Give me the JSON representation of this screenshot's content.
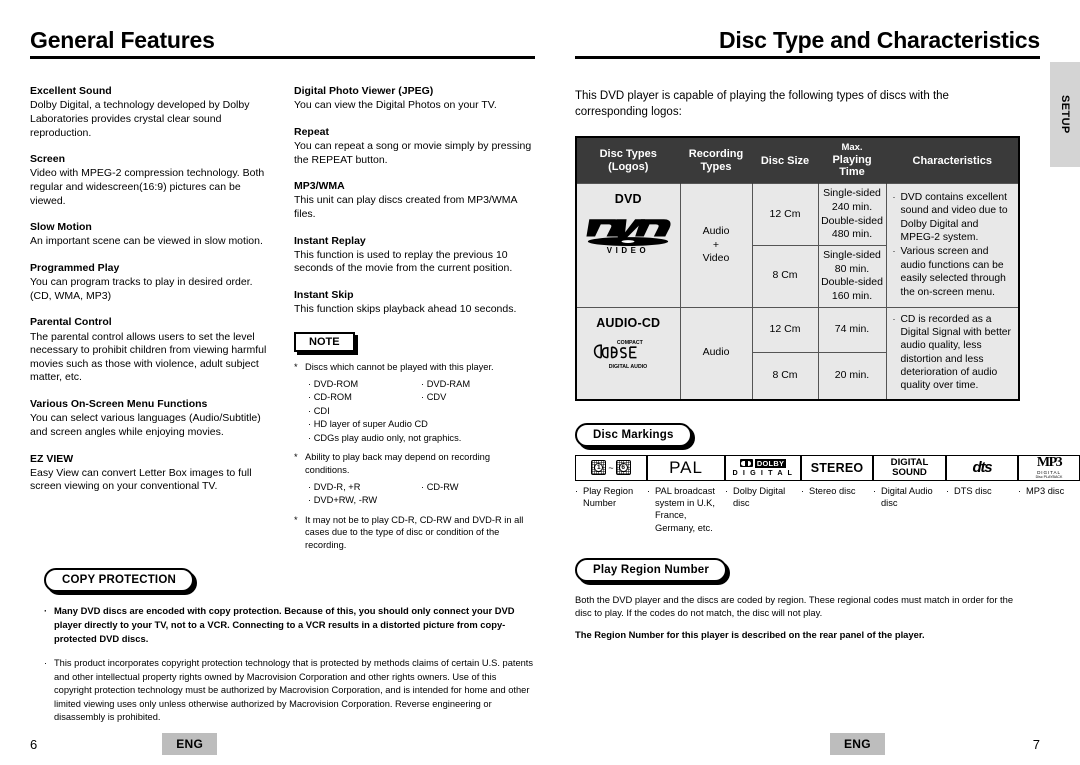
{
  "left_page": {
    "title": "General Features",
    "page_number": "6",
    "language_badge": "ENG",
    "column1": [
      {
        "heading": "Excellent Sound",
        "body": "Dolby Digital, a technology developed by Dolby Laboratories provides crystal clear sound reproduction."
      },
      {
        "heading": "Screen",
        "body": "Video with MPEG-2 compression technology. Both regular and widescreen(16:9) pictures can be viewed."
      },
      {
        "heading": "Slow Motion",
        "body": "An important scene can be viewed in slow motion."
      },
      {
        "heading": "Programmed Play",
        "body": "You can program tracks to play in desired order. (CD, WMA, MP3)"
      },
      {
        "heading": "Parental Control",
        "body": "The parental control allows users to set the level necessary to prohibit children from viewing harmful movies such as those with violence, adult subject matter, etc."
      },
      {
        "heading": "Various On-Screen Menu Functions",
        "body": "You can select various languages (Audio/Subtitle) and screen angles while enjoying movies."
      },
      {
        "heading": "EZ VIEW",
        "body": "Easy View can convert Letter Box images to full screen viewing on your conventional TV."
      }
    ],
    "column2": [
      {
        "heading": "Digital Photo Viewer (JPEG)",
        "body": "You can view the Digital Photos on your TV."
      },
      {
        "heading": "Repeat",
        "body": "You can repeat a song or movie simply by pressing the REPEAT button."
      },
      {
        "heading": "MP3/WMA",
        "body": "This unit can play discs created from MP3/WMA files."
      },
      {
        "heading": "Instant Replay",
        "body": "This function is used to replay the previous 10 seconds of the movie from the current position."
      },
      {
        "heading": "Instant Skip",
        "body": "This function skips playback ahead 10 seconds."
      }
    ],
    "note": {
      "label": "NOTE",
      "star1": "Discs which cannot be played with this player.",
      "list1": [
        "DVD-ROM",
        "DVD-RAM",
        "CD-ROM",
        "CDV"
      ],
      "list1_full": [
        "CDI",
        "HD layer of super Audio CD",
        "CDGs play audio only, not graphics."
      ],
      "star2": "Ability to play back may depend on recording conditions.",
      "list2": [
        "DVD-R, +R",
        "CD-RW"
      ],
      "list2_full": [
        "DVD+RW, -RW"
      ],
      "star3": "It may not be to play CD-R, CD-RW and DVD-R in all cases due to the type of disc or condition of the recording."
    },
    "copy_protection": {
      "label": "COPY PROTECTION",
      "items": [
        "Many DVD discs are encoded with copy protection. Because of this, you should only connect your DVD player directly to your TV, not to a VCR. Connecting to a VCR results in a distorted picture from copy-protected DVD discs.",
        "This product incorporates copyright protection technology that is protected by methods claims of certain U.S. patents and other intellectual property rights owned by Macrovision Corporation and other rights owners. Use of this copyright protection technology must be authorized by Macrovision Corporation, and is intended for home and other limited viewing uses only unless otherwise authorized by Macrovision Corporation. Reverse engineering or disassembly is prohibited."
      ]
    }
  },
  "right_page": {
    "title": "Disc Type and Characteristics",
    "page_number": "7",
    "language_badge": "ENG",
    "side_tab": "SETUP",
    "intro": "This DVD player is capable of playing the following types of discs with the corresponding logos:",
    "table": {
      "headers": [
        {
          "line1": "Disc Types",
          "line2": "(Logos)"
        },
        {
          "line1": "Recording",
          "line2": "Types"
        },
        {
          "line1": "Disc Size",
          "line2": ""
        },
        {
          "line1": "Max.",
          "line2": "Playing Time"
        },
        {
          "line1": "Characteristics",
          "line2": ""
        }
      ],
      "rows": [
        {
          "disc_name": "DVD",
          "logo": "dvd-video-logo",
          "logo_sub": "V I D E O",
          "recording_types": "Audio\n+\nVideo",
          "sizes": [
            {
              "size": "12 Cm",
              "time": "Single-sided\n240 min.\nDouble-sided\n480 min."
            },
            {
              "size": "8 Cm",
              "time": "Single-sided\n80 min.\nDouble-sided\n160 min."
            }
          ],
          "characteristics": [
            "DVD contains excellent sound and video due to Dolby Digital and MPEG-2 system.",
            "Various screen and audio functions can be easily selected through the on-screen menu."
          ]
        },
        {
          "disc_name": "AUDIO-CD",
          "logo": "compact-disc-digital-audio-logo",
          "logo_top": "COMPACT",
          "logo_sub": "DIGITAL AUDIO",
          "recording_types": "Audio",
          "sizes": [
            {
              "size": "12 Cm",
              "time": "74 min."
            },
            {
              "size": "8 Cm",
              "time": "20 min."
            }
          ],
          "characteristics": [
            "CD is recorded as a Digital Signal with better audio quality, less distortion and less deterioration of audio quality over time."
          ]
        }
      ]
    },
    "disc_markings": {
      "label": "Disc Markings",
      "items": [
        {
          "icon": "region-number-icon",
          "glyph_a": "1",
          "glyph_tilde": "~",
          "glyph_b": "6",
          "caption": "Play Region Number"
        },
        {
          "icon": "pal-logo-icon",
          "text": "PAL",
          "caption": "PAL broadcast system in U.K, France, Germany, etc."
        },
        {
          "icon": "dolby-digital-logo-icon",
          "text": "DOLBY",
          "text2": "D I G I T A L",
          "caption": "Dolby Digital disc"
        },
        {
          "icon": "stereo-logo-icon",
          "text": "STEREO",
          "caption": "Stereo disc"
        },
        {
          "icon": "digital-sound-logo-icon",
          "text": "DIGITAL",
          "text2": "SOUND",
          "caption": "Digital Audio disc"
        },
        {
          "icon": "dts-logo-icon",
          "text": "dts",
          "caption": "DTS disc"
        },
        {
          "icon": "mp3-logo-icon",
          "text": "MP3",
          "text2": "DIGITAL",
          "text3": "Disc PLAYBACK",
          "caption": "MP3 disc"
        }
      ]
    },
    "play_region": {
      "label": "Play Region Number",
      "body": "Both the DVD player and the discs are coded by region. These regional codes must match in order for the disc to play. If the codes do not match, the disc will not play.",
      "bold": "The Region Number for this player is described on the rear panel of the player."
    }
  }
}
